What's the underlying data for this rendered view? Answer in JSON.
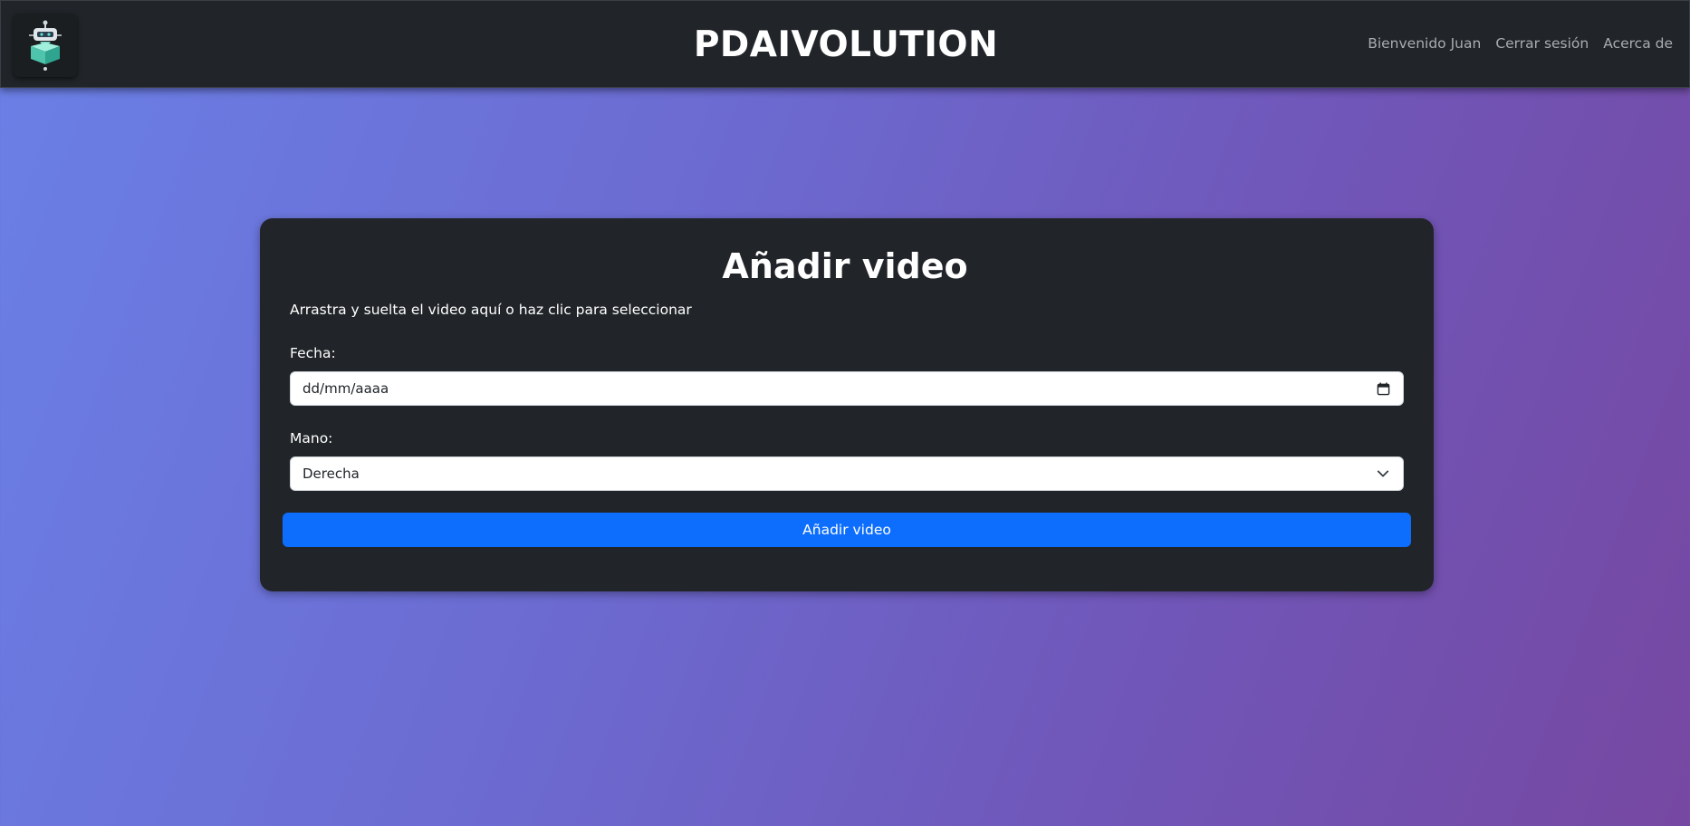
{
  "navbar": {
    "brand": "PDAIVOLUTION",
    "logo_icon": "robot-logo-icon",
    "links": {
      "welcome": "Bienvenido Juan",
      "logout": "Cerrar sesión",
      "about": "Acerca de"
    }
  },
  "form": {
    "title": "Añadir video",
    "drop_text": "Arrastra y suelta el video aquí o haz clic para seleccionar",
    "date_label": "Fecha:",
    "date_placeholder": "dd/mm/aaaa",
    "date_icon": "calendar-icon",
    "hand_label": "Mano:",
    "hand_selected": "Derecha",
    "hand_icon": "chevron-down-icon",
    "submit_label": "Añadir video"
  },
  "colors": {
    "navbar_bg": "#212529",
    "card_bg": "#212529",
    "primary_button": "#0d6efd",
    "gradient_start": "#6a80e6",
    "gradient_end": "#7648a2"
  }
}
